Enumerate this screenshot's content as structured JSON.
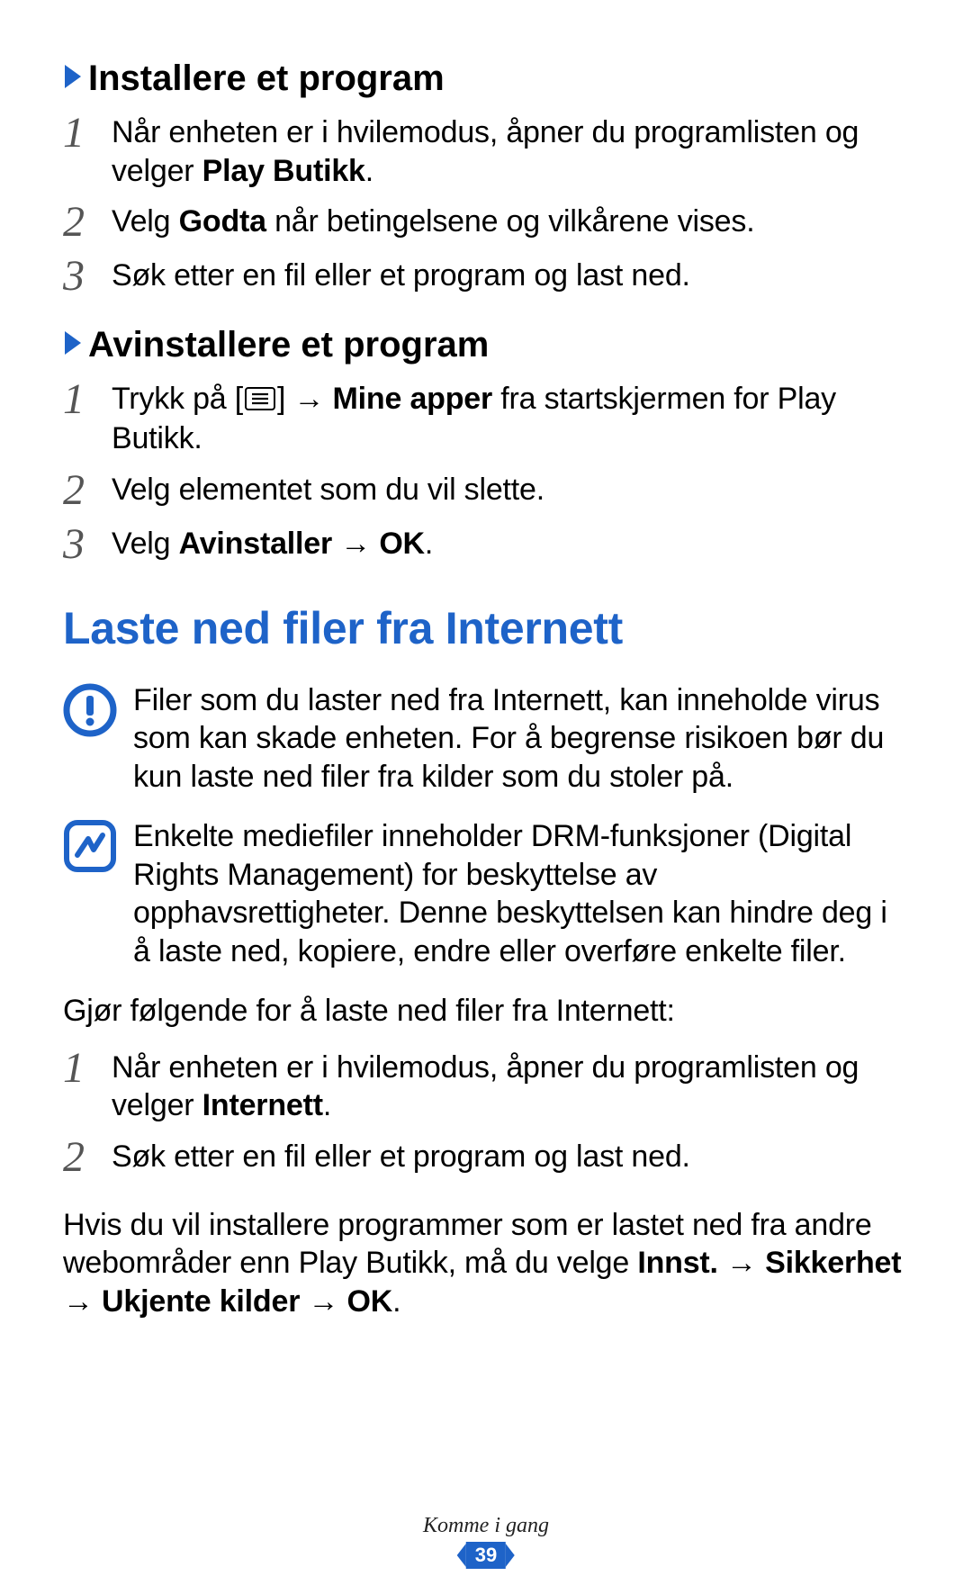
{
  "section1": {
    "heading": "Installere et program",
    "steps": [
      {
        "n": "1",
        "pre": "Når enheten er i hvilemodus, åpner du programlisten og velger ",
        "b1": "Play Butikk",
        "post": "."
      },
      {
        "n": "2",
        "pre": "Velg ",
        "b1": "Godta",
        "mid": " når betingelsene og vilkårene vises."
      },
      {
        "n": "3",
        "pre": "Søk etter en fil eller et program og last ned."
      }
    ]
  },
  "section2": {
    "heading": "Avinstallere et program",
    "steps": [
      {
        "n": "1",
        "pre": "Trykk på [",
        "icon": "menu",
        "mid": "] → ",
        "b1": "Mine apper",
        "post": " fra startskjermen for Play Butikk."
      },
      {
        "n": "2",
        "pre": "Velg elementet som du vil slette."
      },
      {
        "n": "3",
        "pre": "Velg ",
        "b1": "Avinstaller",
        "mid": " → ",
        "b2": "OK",
        "post": "."
      }
    ]
  },
  "main_heading": "Laste ned filer fra Internett",
  "note_warning": "Filer som du laster ned fra Internett, kan inneholde virus som kan skade enheten. For å begrense risikoen bør du kun laste ned filer fra kilder som du stoler på.",
  "note_info": "Enkelte mediefiler inneholder DRM-funksjoner (Digital Rights Management) for beskyttelse av opphavsrettigheter. Denne beskyttelsen kan hindre deg i å laste ned, kopiere, endre eller overføre enkelte filer.",
  "para_intro": "Gjør følgende for å laste ned filer fra Internett:",
  "section3": {
    "steps": [
      {
        "n": "1",
        "pre": "Når enheten er i hvilemodus, åpner du programlisten og velger ",
        "b1": "Internett",
        "post": "."
      },
      {
        "n": "2",
        "pre": "Søk etter en fil eller et program og last ned."
      }
    ]
  },
  "para_after": {
    "pre": "Hvis du vil installere programmer som er lastet ned fra andre webområder enn Play Butikk, må du velge ",
    "b1": "Innst.",
    "a1": " → ",
    "b2": "Sikkerhet",
    "a2": " → ",
    "b3": "Ukjente kilder",
    "a3": " → ",
    "b4": "OK",
    "post": "."
  },
  "footer_text": "Komme i gang",
  "page_number": "39"
}
